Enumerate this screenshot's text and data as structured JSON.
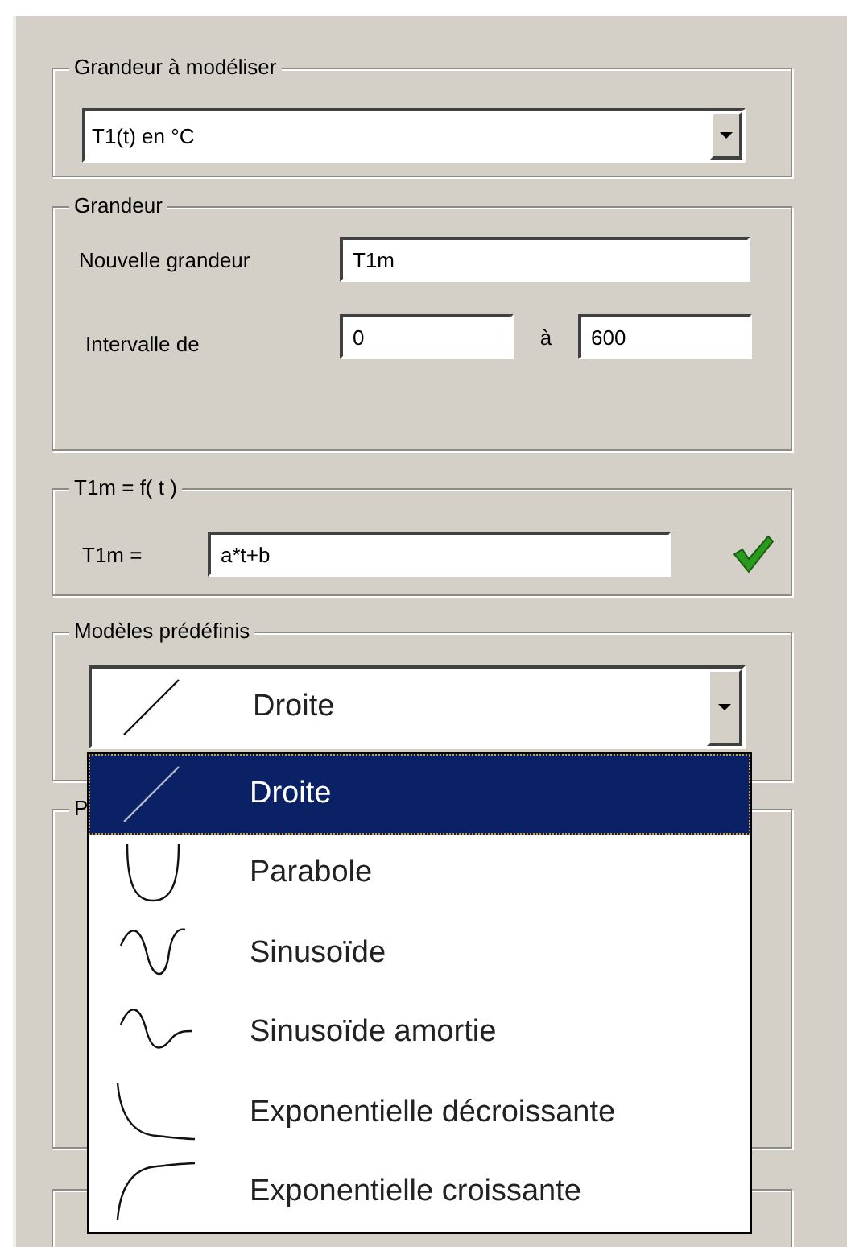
{
  "quantity_group": {
    "title": "Grandeur à modéliser",
    "value": "T1(t) en °C"
  },
  "grandeur_group": {
    "title": "Grandeur",
    "new_label": "Nouvelle grandeur",
    "new_value": "T1m",
    "interval_label": "Intervalle de",
    "from": "0",
    "to_word": "à",
    "to": "600"
  },
  "function_group": {
    "title": "T1m = f( t )",
    "label": "T1m =",
    "value": "a*t+b",
    "valid": true
  },
  "models_group": {
    "title": "Modèles prédéfinis",
    "value": "Droite",
    "open": true,
    "options": [
      {
        "kind": "line",
        "label": "Droite",
        "selected": true
      },
      {
        "kind": "parabola",
        "label": "Parabole",
        "selected": false
      },
      {
        "kind": "sine",
        "label": "Sinusoïde",
        "selected": false
      },
      {
        "kind": "damped",
        "label": "Sinusoïde amortie",
        "selected": false
      },
      {
        "kind": "decay",
        "label": "Exponentielle décroissante",
        "selected": false
      },
      {
        "kind": "growth",
        "label": "Exponentielle croissante",
        "selected": false
      }
    ]
  },
  "hidden_group": {
    "title": "P"
  }
}
